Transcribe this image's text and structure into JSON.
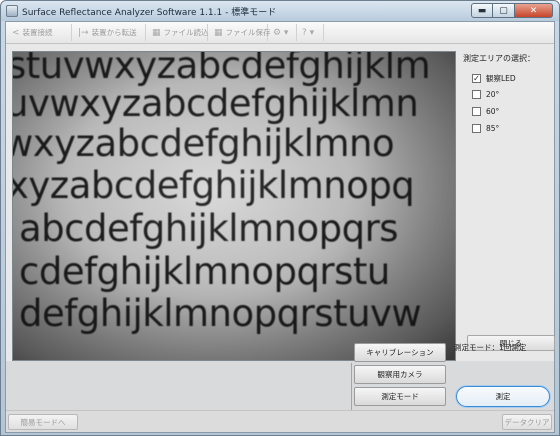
{
  "window": {
    "title": "Surface Reflectance Analyzer Software 1.1.1 - 標準モード",
    "min_icon": "minimize-icon",
    "max_icon": "maximize-icon",
    "close_icon": "close-icon"
  },
  "toolbar": {
    "items": [
      {
        "label": "装置接続",
        "icon": "connect-icon",
        "glyph": "<"
      },
      {
        "label": "装置から転送",
        "icon": "transfer-icon",
        "glyph": "|→"
      },
      {
        "label": "ファイル読込",
        "icon": "folder-icon",
        "glyph": "▦"
      },
      {
        "label": "ファイル保存",
        "icon": "save-icon",
        "glyph": "▦"
      },
      {
        "label": "",
        "icon": "gear-icon",
        "glyph": "⚙ ▾"
      },
      {
        "label": "",
        "icon": "help-icon",
        "glyph": "? ▾"
      }
    ]
  },
  "camera": {
    "lines": [
      "stuvwxyzabcdefghijklm",
      "uvwxyzabcdefghijklmn",
      "wxyzabcdefghijklmno",
      "xyzabcdefghijklmnopq",
      "abcdefghijklmnopqrs",
      "cdefghijklmnopqrstu",
      "defghijklmnopqrstuvw"
    ]
  },
  "panel": {
    "title": "測定エリアの選択：",
    "options": [
      {
        "label": "観察LED",
        "checked": true
      },
      {
        "label": "20°",
        "checked": false
      },
      {
        "label": "60°",
        "checked": false
      },
      {
        "label": "85°",
        "checked": false
      }
    ],
    "close_label": "閉じる"
  },
  "controls": {
    "calibration_label": "キャリブレーション",
    "camera_label": "観察用カメラ",
    "mode_label": "測定モード",
    "mode_status": "測定モード：1回測定",
    "measure_label": "測定"
  },
  "footer": {
    "simple_mode_label": "簡易モードへ",
    "clear_label": "データクリア"
  },
  "colors": {
    "accent": "#3a8bd6",
    "close_button": "#c7452b"
  }
}
